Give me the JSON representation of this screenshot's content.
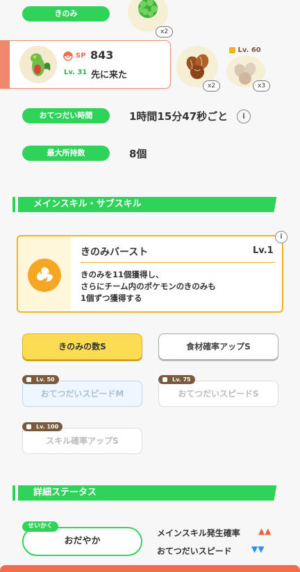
{
  "berries": {
    "label": "きのみ",
    "qty": "x2",
    "icon": "berry-icon"
  },
  "pokemon": {
    "sp_label": "SP",
    "sp_value": "843",
    "level": "Lv. 31",
    "nickname": "先に来た",
    "ingredient_qty_1": "x2",
    "ingredient_qty_2": "x3",
    "ingredient_unlock_level": "Lv. 60"
  },
  "help_time": {
    "label": "おてつだい時間",
    "value": "1時間15分47秒ごと",
    "info_icon": "info-icon"
  },
  "max_carry": {
    "label": "最大所持数",
    "value": "8個"
  },
  "skills_section": {
    "title": "メインスキル・サブスキル"
  },
  "main_skill": {
    "name": "きのみバースト",
    "level": "Lv.1",
    "desc_line1": "きのみを11個獲得し、",
    "desc_line2": "さらにチーム内のポケモンのきのみも",
    "desc_line3": "1個ずつ獲得する",
    "icon": "berry-burst-icon",
    "colors": {
      "border": "#f2b21a",
      "icon_bg": "#f5a623"
    }
  },
  "sub_skills": [
    {
      "label": "きのみの数S",
      "state": "selected",
      "lock": ""
    },
    {
      "label": "食材確率アップS",
      "state": "normal",
      "lock": ""
    },
    {
      "label": "おてつだいスピードM",
      "state": "locked",
      "lock": "Lv. 50"
    },
    {
      "label": "おてつだいスピードS",
      "state": "locked",
      "lock": "Lv. 75"
    },
    {
      "label": "スキル確率アップS",
      "state": "locked",
      "lock": "Lv. 100"
    }
  ],
  "details_section": {
    "title": "詳細ステータス"
  },
  "nature": {
    "tag": "せいかく",
    "value": "おだやか",
    "up_stat": "メインスキル発生確率",
    "down_stat": "おてつだいスピード",
    "up_mark": "▲▲",
    "down_mark": "▼▼",
    "colors": {
      "up": "#f0633a",
      "down": "#2f8ee8"
    }
  }
}
